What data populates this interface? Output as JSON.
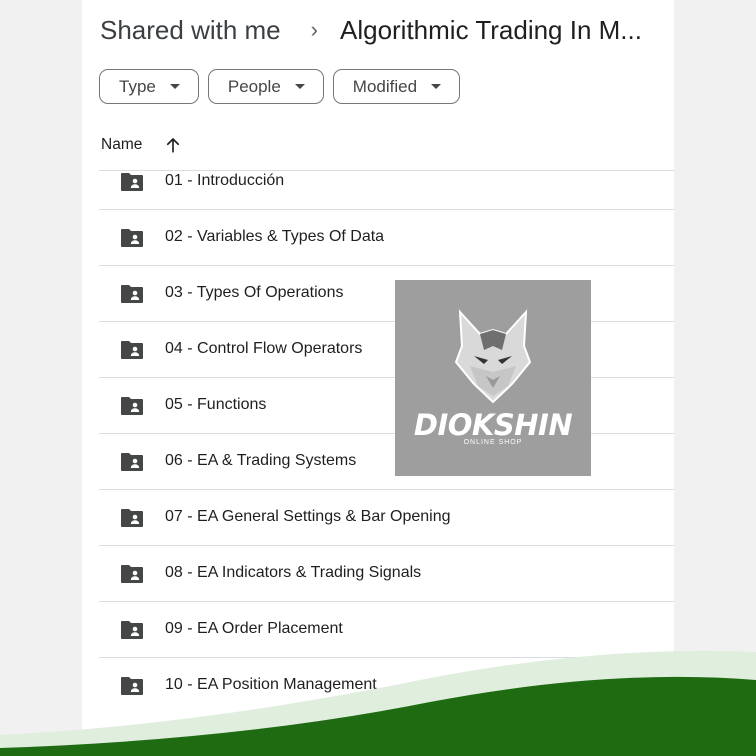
{
  "breadcrumb": {
    "root": "Shared with me",
    "current": "Algorithmic Trading In M..."
  },
  "filters": [
    {
      "label": "Type"
    },
    {
      "label": "People"
    },
    {
      "label": "Modified"
    }
  ],
  "list_header": {
    "name": "Name",
    "sort_icon": "arrow-up-icon"
  },
  "folders": [
    {
      "name": "01 - Introducción"
    },
    {
      "name": "02 - Variables & Types Of Data"
    },
    {
      "name": "03 - Types Of Operations"
    },
    {
      "name": "04 - Control Flow Operators"
    },
    {
      "name": "05 - Functions"
    },
    {
      "name": "06 - EA & Trading Systems"
    },
    {
      "name": "07 - EA General Settings & Bar Opening"
    },
    {
      "name": "08 - EA Indicators & Trading Signals"
    },
    {
      "name": "09 - EA Order Placement"
    },
    {
      "name": "10 - EA Position Management"
    }
  ],
  "watermark": {
    "brand": "DIOKSHIN",
    "tagline": "ONLINE SHOP"
  },
  "colors": {
    "wave_dark": "#1e6b12",
    "wave_light": "#dfeedd",
    "folder_icon": "#444746"
  }
}
